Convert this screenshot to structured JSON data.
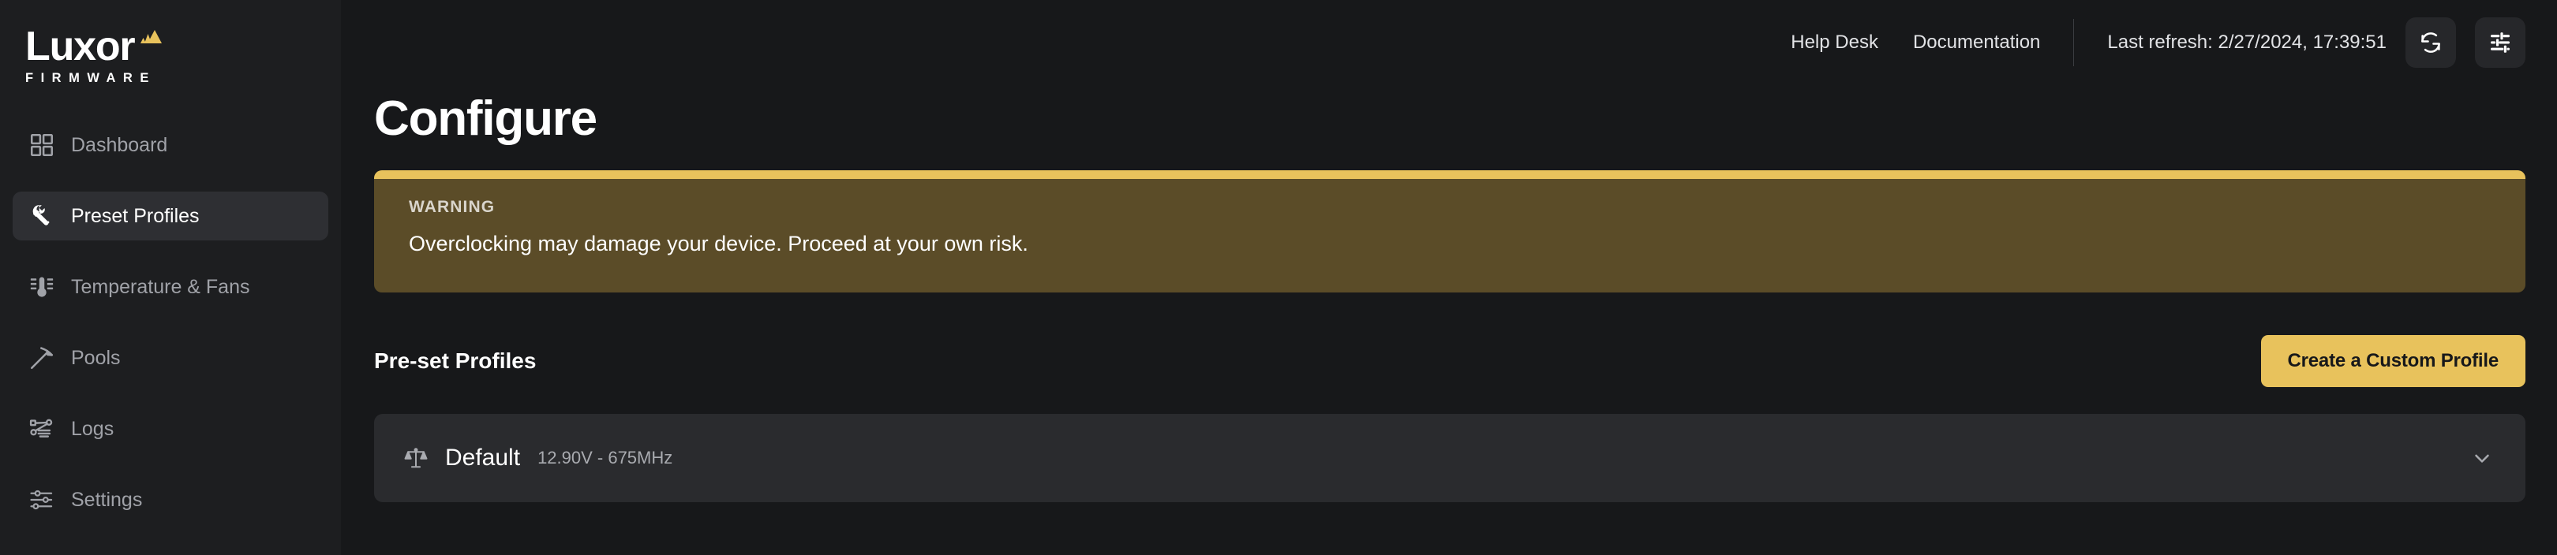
{
  "brand": {
    "name": "Luxor",
    "subtitle": "FIRMWARE",
    "logo_mark": "pyramid-icon",
    "accent_color": "#e8c25c"
  },
  "sidebar": {
    "items": [
      {
        "label": "Dashboard",
        "icon": "grid-icon",
        "active": false
      },
      {
        "label": "Preset Profiles",
        "icon": "wrench-icon",
        "active": true
      },
      {
        "label": "Temperature & Fans",
        "icon": "thermometer-icon",
        "active": false
      },
      {
        "label": "Pools",
        "icon": "pickaxe-icon",
        "active": false
      },
      {
        "label": "Logs",
        "icon": "network-icon",
        "active": false
      },
      {
        "label": "Settings",
        "icon": "sliders-icon",
        "active": false
      }
    ]
  },
  "topbar": {
    "links": [
      {
        "label": "Help Desk"
      },
      {
        "label": "Documentation"
      }
    ],
    "last_refresh": "Last refresh: 2/27/2024, 17:39:51",
    "refresh_button_icon": "refresh-icon",
    "settings_button_icon": "sliders-adjust-icon"
  },
  "page": {
    "title": "Configure"
  },
  "warning": {
    "label": "WARNING",
    "message": "Overclocking may damage your device. Proceed at your own risk.",
    "accent_color": "#e8c25c",
    "background_color": "#5b4c28"
  },
  "profiles_section": {
    "title": "Pre-set Profiles",
    "create_button": "Create a Custom Profile",
    "items": [
      {
        "name": "Default",
        "spec": "12.90V - 675MHz",
        "icon": "scales-icon",
        "expand_icon": "chevron-down-icon"
      }
    ]
  }
}
